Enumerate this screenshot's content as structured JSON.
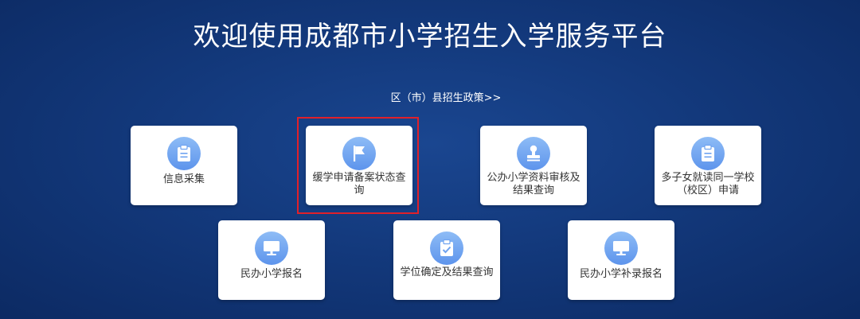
{
  "header": {
    "title": "欢迎使用成都市小学招生入学服务平台"
  },
  "policy_link": {
    "label": "区（市）县招生政策>>"
  },
  "cards": [
    {
      "label": "信息采集",
      "icon": "clipboard-icon"
    },
    {
      "label": "缓学申请备案状态查询",
      "icon": "flag-icon"
    },
    {
      "label": "公办小学资料审核及结果查询",
      "icon": "stamp-icon"
    },
    {
      "label": "多子女就读同一学校（校区）申请",
      "icon": "clipboard-icon"
    },
    {
      "label": "民办小学报名",
      "icon": "monitor-icon"
    },
    {
      "label": "学位确定及结果查询",
      "icon": "clipboard-check-icon"
    },
    {
      "label": "民办小学补录报名",
      "icon": "monitor-icon"
    }
  ],
  "colors": {
    "background": "#13397c",
    "icon_circle": "#6fa3f0",
    "highlight_border": "#e0202a"
  }
}
